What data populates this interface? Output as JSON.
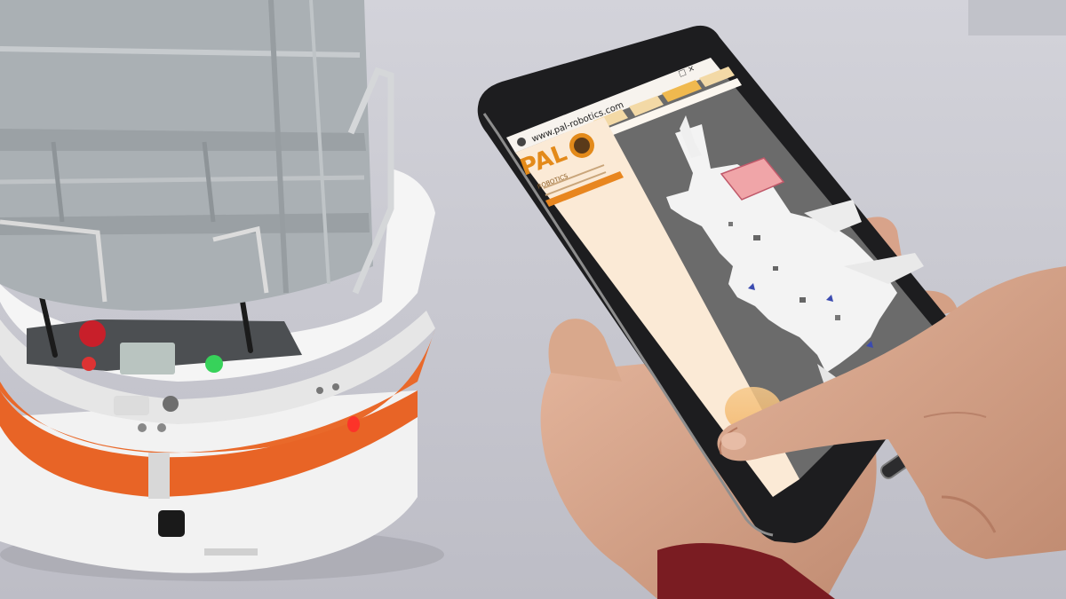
{
  "photo": {
    "subject": "Mobile robot with storage crates next to a hand holding a tablet showing a floor map",
    "colors": {
      "floor": "#c6c6ce",
      "robot_body": "#f1f1f1",
      "robot_stripe": "#ea6a2a",
      "crate": "#a9aeb2",
      "tablet_frame": "#1e1e1e",
      "map_background": "#6a6a6a",
      "map_free_space": "#f4f4f4",
      "map_highlight": "#f0a5a8",
      "sidebar": "#fbe9d4",
      "brand_orange": "#e38a1a",
      "skin": "#d6a58a"
    }
  },
  "tablet": {
    "url": "www.pal-robotics.com",
    "brand_letters": "PAL",
    "brand_subtitle": "ROBOTICS",
    "tabs": [
      {
        "active": false
      },
      {
        "active": false
      },
      {
        "active": true
      },
      {
        "active": false
      }
    ]
  }
}
